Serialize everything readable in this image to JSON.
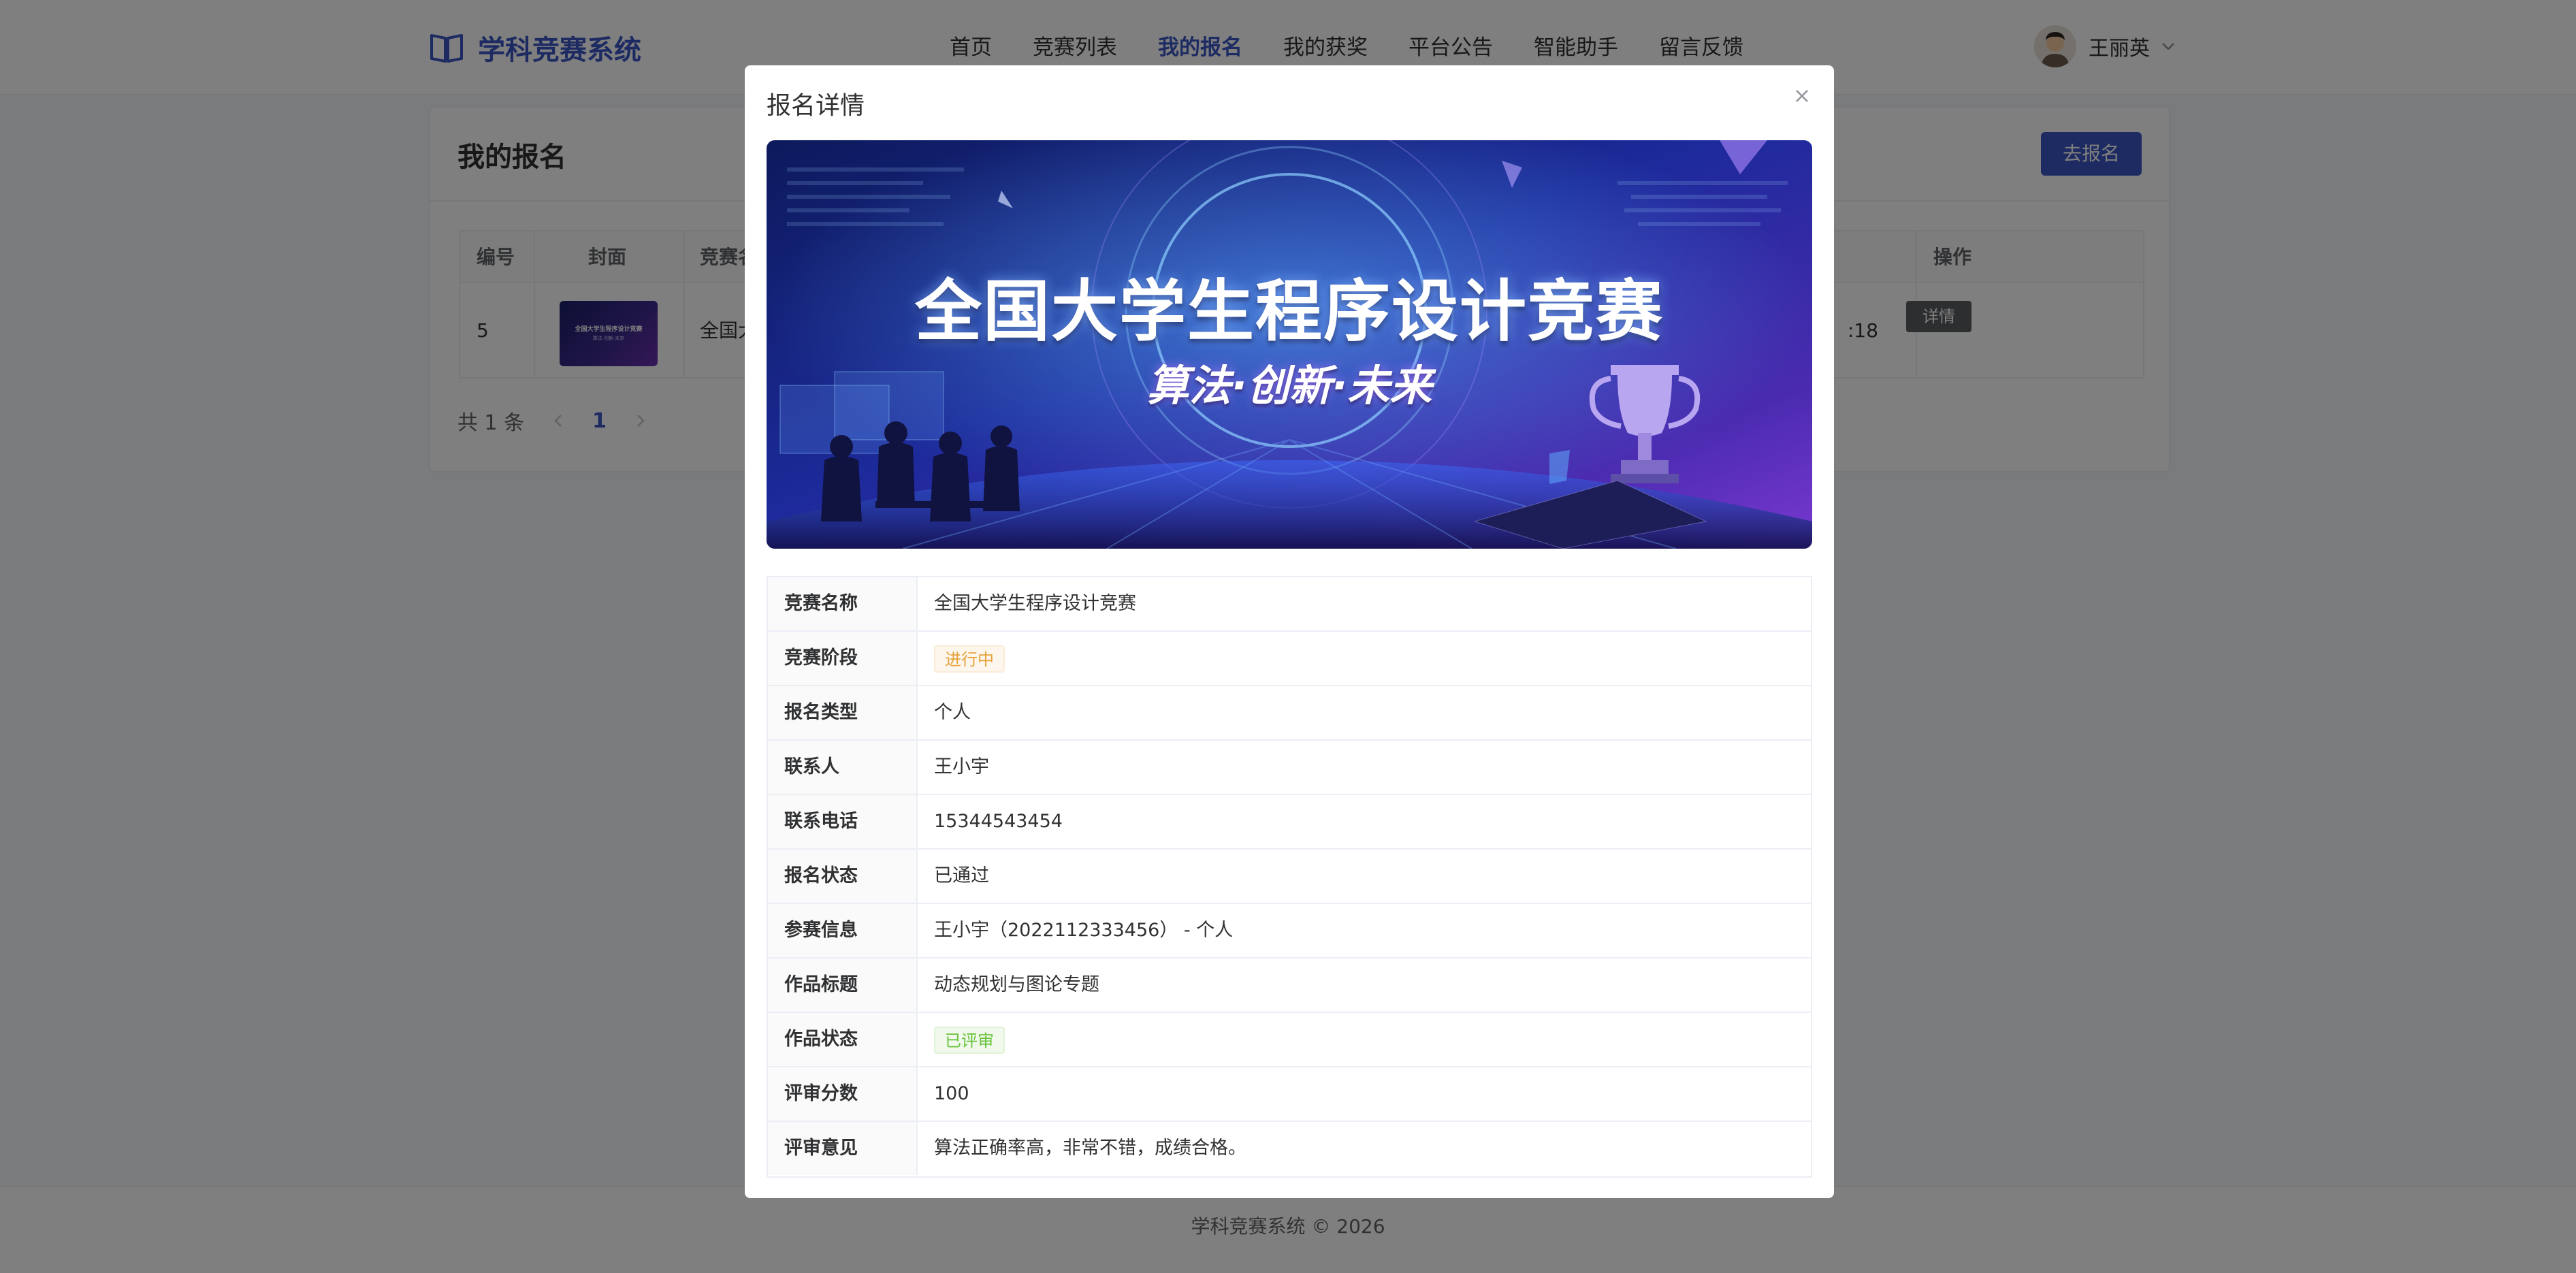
{
  "header": {
    "app_title": "学科竞赛系统",
    "nav": [
      "首页",
      "竞赛列表",
      "我的报名",
      "我的获奖",
      "平台公告",
      "智能助手",
      "留言反馈"
    ],
    "active_nav": "我的报名",
    "user_name": "王丽英",
    "accent_color": "#3a57c4"
  },
  "card": {
    "title": "我的报名",
    "action_label": "去报名",
    "columns": [
      "编号",
      "封面",
      "竞赛名",
      "操作"
    ],
    "row": {
      "id": "5",
      "name_partial": "全国大",
      "time_partial": ":18",
      "cover_text": "全国大学生程序设计竞赛",
      "cover_subtext": "算法·创新·未来",
      "action": "详情"
    },
    "pagination": {
      "total": "共 1 条",
      "current": "1"
    }
  },
  "footer": {
    "text": "学科竞赛系统 © 2026"
  },
  "modal": {
    "title": "报名详情",
    "banner": {
      "title": "全国大学生程序设计竞赛",
      "subtitle": "算法·创新·未来"
    },
    "fields": {
      "competition_name": {
        "label": "竞赛名称",
        "value": "全国大学生程序设计竞赛"
      },
      "stage": {
        "label": "竞赛阶段",
        "value": "进行中"
      },
      "signup_type": {
        "label": "报名类型",
        "value": "个人"
      },
      "contact": {
        "label": "联系人",
        "value": "王小宇"
      },
      "phone": {
        "label": "联系电话",
        "value": "15344543454"
      },
      "signup_status": {
        "label": "报名状态",
        "value": "已通过"
      },
      "participant_info": {
        "label": "参赛信息",
        "value": "王小宇（2022112333456） - 个人"
      },
      "work_title": {
        "label": "作品标题",
        "value": "动态规划与图论专题"
      },
      "work_status": {
        "label": "作品状态",
        "value": "已评审"
      },
      "score": {
        "label": "评审分数",
        "value": "100"
      },
      "comment": {
        "label": "评审意见",
        "value": "算法正确率高，非常不错，成绩合格。"
      }
    }
  }
}
